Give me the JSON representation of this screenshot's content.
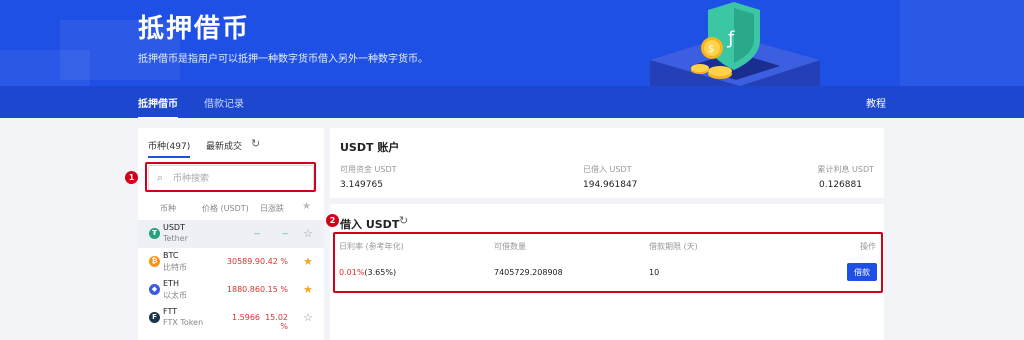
{
  "hero": {
    "title": "抵押借币",
    "subtitle": "抵押借币是指用户可以抵押一种数字货币借入另外一种数字货币。"
  },
  "nav": {
    "tabs": [
      {
        "label": "抵押借币",
        "active": true
      },
      {
        "label": "借款记录",
        "active": false
      }
    ],
    "tutorial": "教程"
  },
  "left_panel": {
    "tabs": [
      {
        "label": "币种(497)",
        "active": true
      },
      {
        "label": "最新成交",
        "active": false
      }
    ],
    "search_placeholder": "币种搜索",
    "headers": {
      "coin": "币种",
      "price": "价格 (USDT)",
      "change": "日涨跌"
    },
    "coins": [
      {
        "symbol": "USDT",
        "name": "Tether",
        "price": "--",
        "change": "--",
        "starred": false,
        "selected": true,
        "logo_color": "#26a17b",
        "logo_glyph": "₮"
      },
      {
        "symbol": "BTC",
        "name": "比特币",
        "price": "30589.9",
        "change": "0.42 %",
        "starred": true,
        "selected": false,
        "logo_color": "#f7931a",
        "logo_glyph": "₿"
      },
      {
        "symbol": "ETH",
        "name": "以太币",
        "price": "1880.86",
        "change": "0.15 %",
        "starred": true,
        "selected": false,
        "logo_color": "#3c5be0",
        "logo_glyph": "◆"
      },
      {
        "symbol": "FTT",
        "name": "FTX Token",
        "price": "1.5966",
        "change": "15.02 %",
        "starred": false,
        "selected": false,
        "logo_color": "#1b3550",
        "logo_glyph": "F"
      }
    ]
  },
  "markers": {
    "one": "1",
    "two": "2"
  },
  "account": {
    "title": "USDT 账户",
    "available_label": "可用资金 USDT",
    "available_value": "3.149765",
    "borrowed_label": "已借入 USDT",
    "borrowed_value": "194.961847",
    "interest_label": "累计利息 USDT",
    "interest_value": "0.126881"
  },
  "borrow": {
    "title": "借入 USDT",
    "headers": {
      "rate": "日利率 (参考年化)",
      "amount": "可借数量",
      "term": "借款期限 (天)",
      "action": "操作"
    },
    "row": {
      "rate": "0.01%",
      "annual": "(3.65%)",
      "amount": "7405729.208908",
      "term": "10",
      "button": "借款"
    }
  },
  "colors": {
    "brand_blue": "#1f50e6",
    "highlight_red": "#d0021b",
    "price_red": "#e03030",
    "star_gold": "#f5a623"
  }
}
